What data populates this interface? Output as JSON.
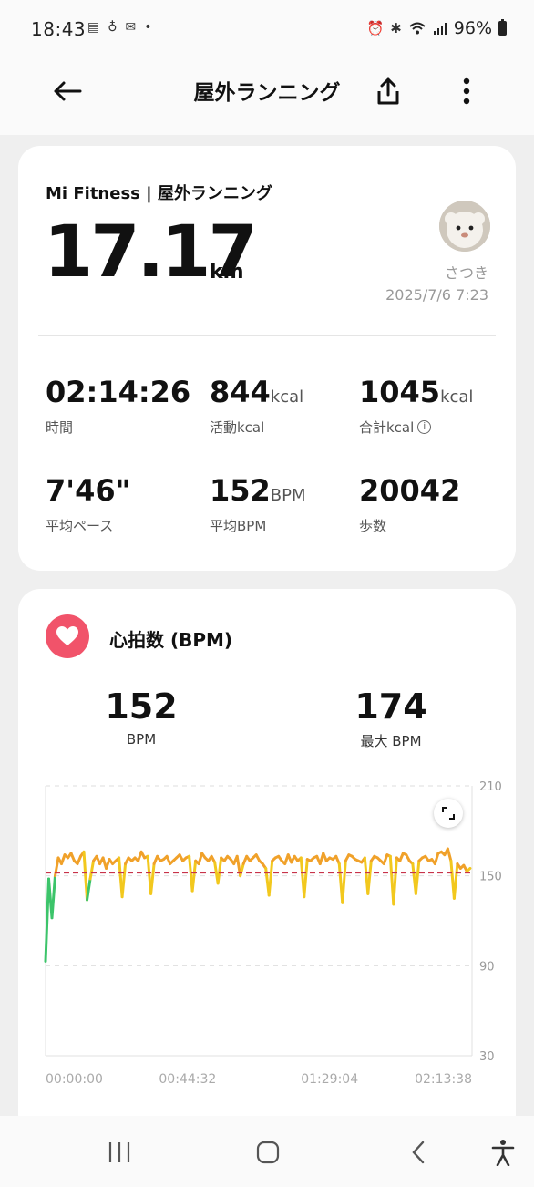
{
  "status_bar": {
    "time": "18:43",
    "battery": "96%",
    "icons": [
      "notification-icons",
      "alarm-icon",
      "bluetooth-icon",
      "wifi-icon",
      "signal-icon",
      "battery-icon"
    ]
  },
  "app_bar": {
    "title": "屋外ランニング",
    "icons": [
      "back-arrow-icon",
      "share-icon",
      "more-vertical-icon"
    ]
  },
  "summary": {
    "source": "Mi Fitness | 屋外ランニング",
    "distance": "17.17",
    "distance_unit": "km",
    "user_name": "さつき",
    "timestamp": "2025/7/6 7:23",
    "stats": [
      {
        "value": "02:14:26",
        "unit": "",
        "label": "時間"
      },
      {
        "value": "844",
        "unit": "kcal",
        "label": "活動kcal"
      },
      {
        "value": "1045",
        "unit": "kcal",
        "label": "合計kcal"
      },
      {
        "value": "7'46\"",
        "unit": "",
        "label": "平均ペース"
      },
      {
        "value": "152",
        "unit": "BPM",
        "label": "平均BPM"
      },
      {
        "value": "20042",
        "unit": "",
        "label": "歩数"
      }
    ]
  },
  "heart_rate": {
    "title": "心拍数 (BPM)",
    "average": "152",
    "average_label": "BPM",
    "max": "174",
    "max_label": "最大 BPM"
  },
  "chart_data": {
    "type": "line",
    "title": "",
    "xlabel": "",
    "ylabel": "",
    "ylim": [
      30,
      210
    ],
    "y_ticks": [
      "210",
      "150",
      "90",
      "30"
    ],
    "x_tick_labels": [
      "00:00:00",
      "00:44:32",
      "01:29:04",
      "02:13:38"
    ],
    "x_unit": "minutes",
    "xlim": [
      0,
      133.6
    ],
    "reference_line": 152,
    "zone_colors": {
      "low": "#3a8fd8",
      "moderate": "#3cc46a",
      "aerobic": "#f2c81e",
      "anaerobic": "#f0a12a",
      "max": "#d9558f"
    },
    "series": [
      {
        "x": [
          0,
          1,
          2,
          3,
          4,
          5,
          6,
          7,
          8,
          9,
          10,
          11,
          12,
          13,
          14,
          15,
          16,
          17,
          18,
          19,
          20,
          21,
          22,
          23,
          24,
          25,
          26,
          27,
          28,
          29,
          30,
          31,
          32,
          33,
          34,
          35,
          36,
          37,
          38,
          39,
          40,
          41,
          42,
          43,
          44,
          45,
          46,
          47,
          48,
          49,
          50,
          51,
          52,
          53,
          54,
          55,
          56,
          57,
          58,
          59,
          60,
          61,
          62,
          63,
          64,
          65,
          66,
          67,
          68,
          69,
          70,
          71,
          72,
          73,
          74,
          75,
          76,
          77,
          78,
          79,
          80,
          81,
          82,
          83,
          84,
          85,
          86,
          87,
          88,
          89,
          90,
          91,
          92,
          93,
          94,
          95,
          96,
          97,
          98,
          99,
          100,
          101,
          102,
          103,
          104,
          105,
          106,
          107,
          108,
          109,
          110,
          111,
          112,
          113,
          114,
          115,
          116,
          117,
          118,
          119,
          120,
          121,
          122,
          123,
          124,
          125,
          126,
          127,
          128,
          129,
          130,
          131,
          132,
          133
        ],
        "values": [
          93,
          148,
          122,
          150,
          162,
          158,
          164,
          162,
          165,
          160,
          158,
          163,
          166,
          134,
          148,
          160,
          163,
          158,
          162,
          155,
          161,
          158,
          160,
          162,
          136,
          158,
          162,
          160,
          162,
          160,
          166,
          162,
          163,
          138,
          158,
          163,
          160,
          161,
          163,
          158,
          160,
          162,
          164,
          160,
          162,
          163,
          140,
          160,
          158,
          165,
          162,
          160,
          163,
          159,
          145,
          162,
          160,
          163,
          161,
          158,
          163,
          150,
          158,
          163,
          160,
          162,
          164,
          160,
          158,
          155,
          137,
          160,
          162,
          163,
          160,
          158,
          164,
          159,
          163,
          160,
          162,
          136,
          161,
          160,
          162,
          163,
          158,
          165,
          160,
          162,
          161,
          163,
          158,
          132,
          160,
          164,
          163,
          161,
          160,
          159,
          162,
          138,
          160,
          163,
          162,
          160,
          158,
          164,
          163,
          131,
          162,
          160,
          165,
          164,
          160,
          158,
          138,
          160,
          162,
          163,
          160,
          161,
          158,
          165,
          166,
          164,
          168,
          160,
          135,
          158,
          155,
          157,
          153,
          155
        ]
      }
    ]
  },
  "nav_bar": {
    "icons": [
      "recent-apps-icon",
      "home-icon",
      "back-icon",
      "accessibility-icon"
    ]
  }
}
